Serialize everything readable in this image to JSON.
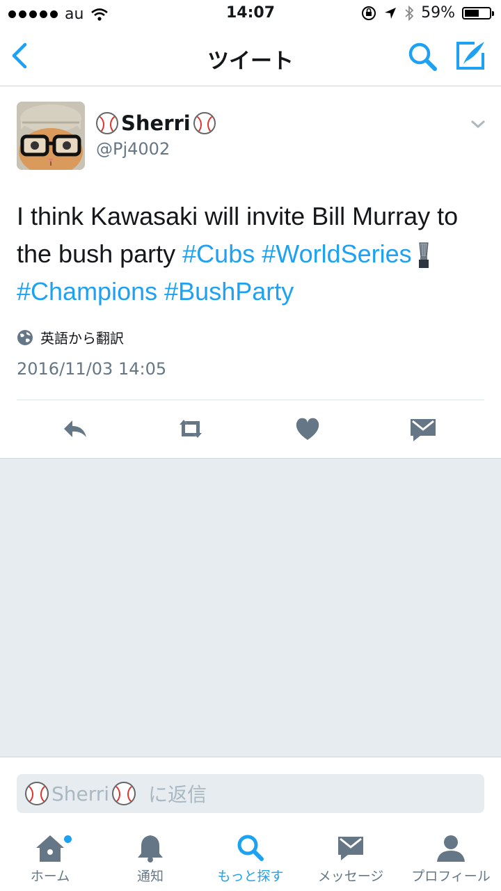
{
  "status_bar": {
    "carrier": "au",
    "time": "14:07",
    "battery_percent": "59%",
    "battery_level": 0.59
  },
  "nav": {
    "title": "ツイート",
    "back_icon": "chevron-left-icon",
    "search_icon": "search-icon",
    "compose_icon": "compose-icon"
  },
  "tweet": {
    "display_name": "Sherri",
    "handle": "@Pj4002",
    "text_parts": {
      "plain1": "I think Kawasaki will invite Bill Murray to the bush party ",
      "tag1": "#Cubs",
      "sp1": " ",
      "tag2": "#WorldSeries",
      "tag3": "#Champions",
      "sp2": " ",
      "tag4": "#BushParty"
    },
    "translate_label": "英語から翻訳",
    "timestamp": "2016/11/03 14:05"
  },
  "reply": {
    "name": "Sherri",
    "suffix": "に返信"
  },
  "tabs": [
    {
      "label": "ホーム",
      "icon": "home-icon"
    },
    {
      "label": "通知",
      "icon": "bell-icon"
    },
    {
      "label": "もっと探す",
      "icon": "search-icon"
    },
    {
      "label": "メッセージ",
      "icon": "envelope-icon"
    },
    {
      "label": "プロフィール",
      "icon": "person-icon"
    }
  ],
  "colors": {
    "accent": "#1da1f2",
    "gray": "#657786",
    "background": "#e6ecf0"
  }
}
